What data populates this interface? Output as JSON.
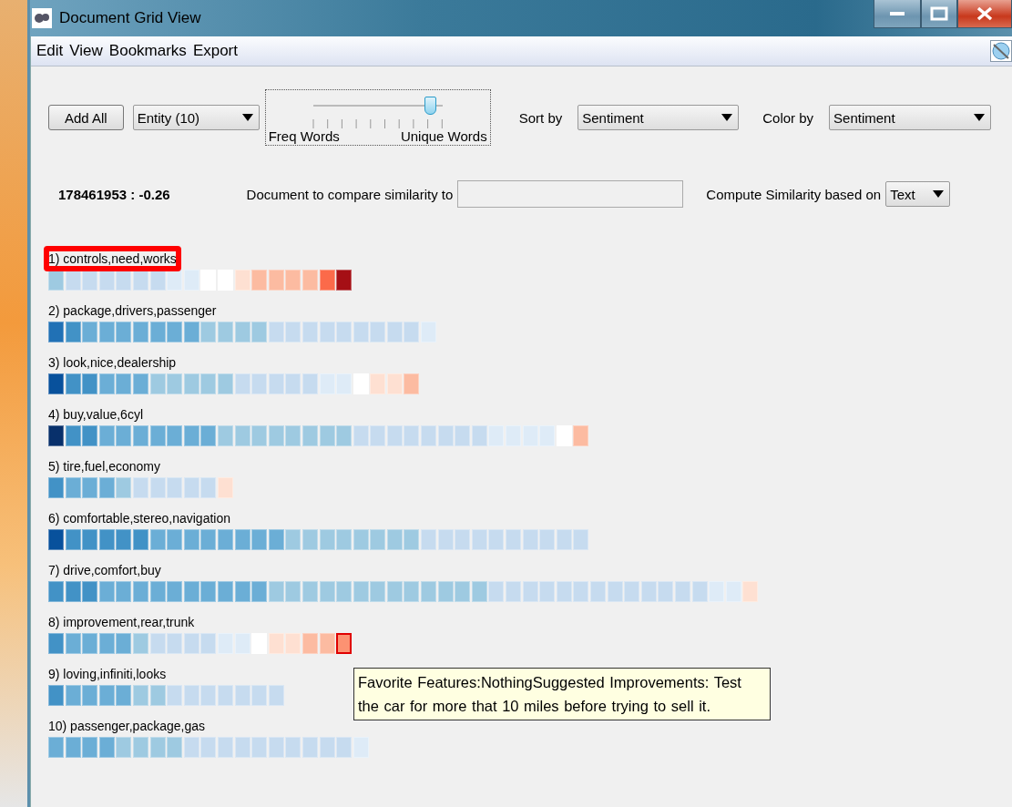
{
  "window": {
    "title": "Document Grid View"
  },
  "menu": [
    "Edit",
    "View",
    "Bookmarks",
    "Export"
  ],
  "toolbar": {
    "add_button": "Add All",
    "entity_select": "Entity (10)",
    "slider": {
      "level": 0.91,
      "left_label": "Freq Words",
      "right_label": "Unique Words"
    },
    "sort_label": "Sort by",
    "sort_select": "Sentiment",
    "color_label": "Color by",
    "color_select": "Sentiment"
  },
  "info": {
    "score": "178461953 : -0.26",
    "compare_label": "Document to compare similarity to",
    "similarity_label": "Compute Similarity based on",
    "similarity_select": "Text"
  },
  "rows": [
    {
      "label": "1) controls,need,works",
      "highlighted": true,
      "cells": [
        {
          "color": "#9ecae1",
          "selected": false
        },
        {
          "color": "#c6dbef",
          "selected": false
        },
        {
          "color": "#c6dbef",
          "selected": false
        },
        {
          "color": "#c6dbef",
          "selected": false
        },
        {
          "color": "#c6dbef",
          "selected": false
        },
        {
          "color": "#c6dbef",
          "selected": false
        },
        {
          "color": "#c6dbef",
          "selected": false
        },
        {
          "color": "#deebf7",
          "selected": false
        },
        {
          "color": "#deebf7",
          "selected": false
        },
        {
          "color": "#ffffff",
          "selected": false
        },
        {
          "color": "#ffffff",
          "selected": false
        },
        {
          "color": "#fee0d2",
          "selected": false
        },
        {
          "color": "#fcbba1",
          "selected": false
        },
        {
          "color": "#fcbba1",
          "selected": false
        },
        {
          "color": "#fcbba1",
          "selected": false
        },
        {
          "color": "#fcbba1",
          "selected": false
        },
        {
          "color": "#fb6a4a",
          "selected": false
        },
        {
          "color": "#a50f15",
          "selected": false
        }
      ]
    },
    {
      "label": "2) package,drivers,passenger",
      "highlighted": false,
      "cells": [
        {
          "color": "#2171b5",
          "selected": false
        },
        {
          "color": "#4292c6",
          "selected": false
        },
        {
          "color": "#6baed6",
          "selected": false
        },
        {
          "color": "#6baed6",
          "selected": false
        },
        {
          "color": "#6baed6",
          "selected": false
        },
        {
          "color": "#6baed6",
          "selected": false
        },
        {
          "color": "#6baed6",
          "selected": false
        },
        {
          "color": "#6baed6",
          "selected": false
        },
        {
          "color": "#6baed6",
          "selected": false
        },
        {
          "color": "#9ecae1",
          "selected": false
        },
        {
          "color": "#9ecae1",
          "selected": false
        },
        {
          "color": "#9ecae1",
          "selected": false
        },
        {
          "color": "#9ecae1",
          "selected": false
        },
        {
          "color": "#c6dbef",
          "selected": false
        },
        {
          "color": "#c6dbef",
          "selected": false
        },
        {
          "color": "#c6dbef",
          "selected": false
        },
        {
          "color": "#c6dbef",
          "selected": false
        },
        {
          "color": "#c6dbef",
          "selected": false
        },
        {
          "color": "#c6dbef",
          "selected": false
        },
        {
          "color": "#c6dbef",
          "selected": false
        },
        {
          "color": "#c6dbef",
          "selected": false
        },
        {
          "color": "#c6dbef",
          "selected": false
        },
        {
          "color": "#deebf7",
          "selected": false
        }
      ]
    },
    {
      "label": "3) look,nice,dealership",
      "highlighted": false,
      "cells": [
        {
          "color": "#08519c",
          "selected": false
        },
        {
          "color": "#4292c6",
          "selected": false
        },
        {
          "color": "#4292c6",
          "selected": false
        },
        {
          "color": "#6baed6",
          "selected": false
        },
        {
          "color": "#6baed6",
          "selected": false
        },
        {
          "color": "#6baed6",
          "selected": false
        },
        {
          "color": "#9ecae1",
          "selected": false
        },
        {
          "color": "#9ecae1",
          "selected": false
        },
        {
          "color": "#9ecae1",
          "selected": false
        },
        {
          "color": "#9ecae1",
          "selected": false
        },
        {
          "color": "#9ecae1",
          "selected": false
        },
        {
          "color": "#c6dbef",
          "selected": false
        },
        {
          "color": "#c6dbef",
          "selected": false
        },
        {
          "color": "#c6dbef",
          "selected": false
        },
        {
          "color": "#c6dbef",
          "selected": false
        },
        {
          "color": "#c6dbef",
          "selected": false
        },
        {
          "color": "#deebf7",
          "selected": false
        },
        {
          "color": "#deebf7",
          "selected": false
        },
        {
          "color": "#ffffff",
          "selected": false
        },
        {
          "color": "#fee0d2",
          "selected": false
        },
        {
          "color": "#fee0d2",
          "selected": false
        },
        {
          "color": "#fcbba1",
          "selected": false
        }
      ]
    },
    {
      "label": "4) buy,value,6cyl",
      "highlighted": false,
      "cells": [
        {
          "color": "#08306b",
          "selected": false
        },
        {
          "color": "#4292c6",
          "selected": false
        },
        {
          "color": "#4292c6",
          "selected": false
        },
        {
          "color": "#6baed6",
          "selected": false
        },
        {
          "color": "#6baed6",
          "selected": false
        },
        {
          "color": "#6baed6",
          "selected": false
        },
        {
          "color": "#6baed6",
          "selected": false
        },
        {
          "color": "#6baed6",
          "selected": false
        },
        {
          "color": "#6baed6",
          "selected": false
        },
        {
          "color": "#6baed6",
          "selected": false
        },
        {
          "color": "#9ecae1",
          "selected": false
        },
        {
          "color": "#9ecae1",
          "selected": false
        },
        {
          "color": "#9ecae1",
          "selected": false
        },
        {
          "color": "#9ecae1",
          "selected": false
        },
        {
          "color": "#9ecae1",
          "selected": false
        },
        {
          "color": "#9ecae1",
          "selected": false
        },
        {
          "color": "#9ecae1",
          "selected": false
        },
        {
          "color": "#9ecae1",
          "selected": false
        },
        {
          "color": "#c6dbef",
          "selected": false
        },
        {
          "color": "#c6dbef",
          "selected": false
        },
        {
          "color": "#c6dbef",
          "selected": false
        },
        {
          "color": "#c6dbef",
          "selected": false
        },
        {
          "color": "#c6dbef",
          "selected": false
        },
        {
          "color": "#c6dbef",
          "selected": false
        },
        {
          "color": "#c6dbef",
          "selected": false
        },
        {
          "color": "#c6dbef",
          "selected": false
        },
        {
          "color": "#deebf7",
          "selected": false
        },
        {
          "color": "#deebf7",
          "selected": false
        },
        {
          "color": "#deebf7",
          "selected": false
        },
        {
          "color": "#deebf7",
          "selected": false
        },
        {
          "color": "#ffffff",
          "selected": false
        },
        {
          "color": "#fcbba1",
          "selected": false
        }
      ]
    },
    {
      "label": "5) tire,fuel,economy",
      "highlighted": false,
      "cells": [
        {
          "color": "#4292c6",
          "selected": false
        },
        {
          "color": "#6baed6",
          "selected": false
        },
        {
          "color": "#6baed6",
          "selected": false
        },
        {
          "color": "#6baed6",
          "selected": false
        },
        {
          "color": "#9ecae1",
          "selected": false
        },
        {
          "color": "#c6dbef",
          "selected": false
        },
        {
          "color": "#c6dbef",
          "selected": false
        },
        {
          "color": "#c6dbef",
          "selected": false
        },
        {
          "color": "#c6dbef",
          "selected": false
        },
        {
          "color": "#c6dbef",
          "selected": false
        },
        {
          "color": "#fee0d2",
          "selected": false
        }
      ]
    },
    {
      "label": "6) comfortable,stereo,navigation",
      "highlighted": false,
      "cells": [
        {
          "color": "#08519c",
          "selected": false
        },
        {
          "color": "#4292c6",
          "selected": false
        },
        {
          "color": "#4292c6",
          "selected": false
        },
        {
          "color": "#4292c6",
          "selected": false
        },
        {
          "color": "#4292c6",
          "selected": false
        },
        {
          "color": "#4292c6",
          "selected": false
        },
        {
          "color": "#6baed6",
          "selected": false
        },
        {
          "color": "#6baed6",
          "selected": false
        },
        {
          "color": "#6baed6",
          "selected": false
        },
        {
          "color": "#6baed6",
          "selected": false
        },
        {
          "color": "#6baed6",
          "selected": false
        },
        {
          "color": "#6baed6",
          "selected": false
        },
        {
          "color": "#6baed6",
          "selected": false
        },
        {
          "color": "#6baed6",
          "selected": false
        },
        {
          "color": "#9ecae1",
          "selected": false
        },
        {
          "color": "#9ecae1",
          "selected": false
        },
        {
          "color": "#9ecae1",
          "selected": false
        },
        {
          "color": "#9ecae1",
          "selected": false
        },
        {
          "color": "#9ecae1",
          "selected": false
        },
        {
          "color": "#9ecae1",
          "selected": false
        },
        {
          "color": "#9ecae1",
          "selected": false
        },
        {
          "color": "#9ecae1",
          "selected": false
        },
        {
          "color": "#c6dbef",
          "selected": false
        },
        {
          "color": "#c6dbef",
          "selected": false
        },
        {
          "color": "#c6dbef",
          "selected": false
        },
        {
          "color": "#c6dbef",
          "selected": false
        },
        {
          "color": "#c6dbef",
          "selected": false
        },
        {
          "color": "#c6dbef",
          "selected": false
        },
        {
          "color": "#c6dbef",
          "selected": false
        },
        {
          "color": "#c6dbef",
          "selected": false
        },
        {
          "color": "#c6dbef",
          "selected": false
        },
        {
          "color": "#c6dbef",
          "selected": false
        }
      ]
    },
    {
      "label": "7) drive,comfort,buy",
      "highlighted": false,
      "cells": [
        {
          "color": "#4292c6",
          "selected": false
        },
        {
          "color": "#4292c6",
          "selected": false
        },
        {
          "color": "#4292c6",
          "selected": false
        },
        {
          "color": "#6baed6",
          "selected": false
        },
        {
          "color": "#6baed6",
          "selected": false
        },
        {
          "color": "#6baed6",
          "selected": false
        },
        {
          "color": "#6baed6",
          "selected": false
        },
        {
          "color": "#6baed6",
          "selected": false
        },
        {
          "color": "#6baed6",
          "selected": false
        },
        {
          "color": "#6baed6",
          "selected": false
        },
        {
          "color": "#6baed6",
          "selected": false
        },
        {
          "color": "#6baed6",
          "selected": false
        },
        {
          "color": "#6baed6",
          "selected": false
        },
        {
          "color": "#9ecae1",
          "selected": false
        },
        {
          "color": "#9ecae1",
          "selected": false
        },
        {
          "color": "#9ecae1",
          "selected": false
        },
        {
          "color": "#9ecae1",
          "selected": false
        },
        {
          "color": "#9ecae1",
          "selected": false
        },
        {
          "color": "#9ecae1",
          "selected": false
        },
        {
          "color": "#9ecae1",
          "selected": false
        },
        {
          "color": "#9ecae1",
          "selected": false
        },
        {
          "color": "#9ecae1",
          "selected": false
        },
        {
          "color": "#9ecae1",
          "selected": false
        },
        {
          "color": "#9ecae1",
          "selected": false
        },
        {
          "color": "#9ecae1",
          "selected": false
        },
        {
          "color": "#9ecae1",
          "selected": false
        },
        {
          "color": "#c6dbef",
          "selected": false
        },
        {
          "color": "#c6dbef",
          "selected": false
        },
        {
          "color": "#c6dbef",
          "selected": false
        },
        {
          "color": "#c6dbef",
          "selected": false
        },
        {
          "color": "#c6dbef",
          "selected": false
        },
        {
          "color": "#c6dbef",
          "selected": false
        },
        {
          "color": "#c6dbef",
          "selected": false
        },
        {
          "color": "#c6dbef",
          "selected": false
        },
        {
          "color": "#c6dbef",
          "selected": false
        },
        {
          "color": "#c6dbef",
          "selected": false
        },
        {
          "color": "#c6dbef",
          "selected": false
        },
        {
          "color": "#c6dbef",
          "selected": false
        },
        {
          "color": "#c6dbef",
          "selected": false
        },
        {
          "color": "#deebf7",
          "selected": false
        },
        {
          "color": "#deebf7",
          "selected": false
        },
        {
          "color": "#fee0d2",
          "selected": false
        }
      ]
    },
    {
      "label": "8) improvement,rear,trunk",
      "highlighted": false,
      "cells": [
        {
          "color": "#4292c6",
          "selected": false
        },
        {
          "color": "#6baed6",
          "selected": false
        },
        {
          "color": "#6baed6",
          "selected": false
        },
        {
          "color": "#6baed6",
          "selected": false
        },
        {
          "color": "#6baed6",
          "selected": false
        },
        {
          "color": "#9ecae1",
          "selected": false
        },
        {
          "color": "#c6dbef",
          "selected": false
        },
        {
          "color": "#c6dbef",
          "selected": false
        },
        {
          "color": "#c6dbef",
          "selected": false
        },
        {
          "color": "#c6dbef",
          "selected": false
        },
        {
          "color": "#deebf7",
          "selected": false
        },
        {
          "color": "#deebf7",
          "selected": false
        },
        {
          "color": "#ffffff",
          "selected": false
        },
        {
          "color": "#fee0d2",
          "selected": false
        },
        {
          "color": "#fee0d2",
          "selected": false
        },
        {
          "color": "#fcbba1",
          "selected": false
        },
        {
          "color": "#fcbba1",
          "selected": false
        },
        {
          "color": "#fc9272",
          "selected": true
        }
      ]
    },
    {
      "label": "9) loving,infiniti,looks",
      "highlighted": false,
      "cells": [
        {
          "color": "#4292c6",
          "selected": false
        },
        {
          "color": "#6baed6",
          "selected": false
        },
        {
          "color": "#6baed6",
          "selected": false
        },
        {
          "color": "#6baed6",
          "selected": false
        },
        {
          "color": "#6baed6",
          "selected": false
        },
        {
          "color": "#9ecae1",
          "selected": false
        },
        {
          "color": "#9ecae1",
          "selected": false
        },
        {
          "color": "#c6dbef",
          "selected": false
        },
        {
          "color": "#c6dbef",
          "selected": false
        },
        {
          "color": "#c6dbef",
          "selected": false
        },
        {
          "color": "#c6dbef",
          "selected": false
        },
        {
          "color": "#c6dbef",
          "selected": false
        },
        {
          "color": "#c6dbef",
          "selected": false
        },
        {
          "color": "#c6dbef",
          "selected": false
        }
      ]
    },
    {
      "label": "10) passenger,package,gas",
      "highlighted": false,
      "cells": [
        {
          "color": "#6baed6",
          "selected": false
        },
        {
          "color": "#6baed6",
          "selected": false
        },
        {
          "color": "#6baed6",
          "selected": false
        },
        {
          "color": "#6baed6",
          "selected": false
        },
        {
          "color": "#9ecae1",
          "selected": false
        },
        {
          "color": "#9ecae1",
          "selected": false
        },
        {
          "color": "#9ecae1",
          "selected": false
        },
        {
          "color": "#9ecae1",
          "selected": false
        },
        {
          "color": "#c6dbef",
          "selected": false
        },
        {
          "color": "#c6dbef",
          "selected": false
        },
        {
          "color": "#c6dbef",
          "selected": false
        },
        {
          "color": "#c6dbef",
          "selected": false
        },
        {
          "color": "#c6dbef",
          "selected": false
        },
        {
          "color": "#c6dbef",
          "selected": false
        },
        {
          "color": "#c6dbef",
          "selected": false
        },
        {
          "color": "#c6dbef",
          "selected": false
        },
        {
          "color": "#c6dbef",
          "selected": false
        },
        {
          "color": "#c6dbef",
          "selected": false
        },
        {
          "color": "#deebf7",
          "selected": false
        }
      ]
    }
  ],
  "tooltip": {
    "text": "Favorite Features:NothingSuggested Improvements: Test the car for more that 10 miles before trying to sell it."
  }
}
